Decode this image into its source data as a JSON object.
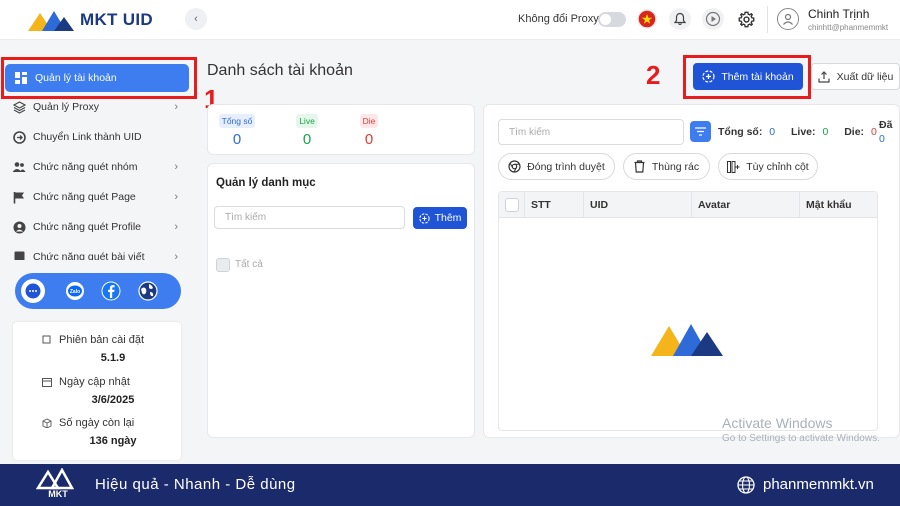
{
  "app": {
    "logo_text": "MKT UID"
  },
  "topbar": {
    "proxy_label": "Không đổi Proxy",
    "proxy_enabled": false,
    "user_name": "Chinh Trịnh",
    "user_email": "chinhtt@phanmemmkt"
  },
  "sidebar": {
    "items": [
      {
        "label": "Quản lý tài khoản",
        "icon": "grid-icon",
        "active": true
      },
      {
        "label": "Quản lý Proxy",
        "icon": "layers-icon",
        "has_children": true
      },
      {
        "label": "Chuyển Link thành UID",
        "icon": "link-icon"
      },
      {
        "label": "Chức năng quét nhóm",
        "icon": "users-icon",
        "has_children": true
      },
      {
        "label": "Chức năng quét Page",
        "icon": "flag-icon",
        "has_children": true
      },
      {
        "label": "Chức năng quét Profile",
        "icon": "user-circle-icon",
        "has_children": true
      },
      {
        "label": "Chức năng quét bài viết",
        "icon": "document-icon",
        "has_children": true
      }
    ],
    "social": [
      "chat-support-icon",
      "zalo-icon",
      "facebook-icon",
      "globe-icon"
    ],
    "info": {
      "version_label": "Phiên bản cài đặt",
      "version_value": "5.1.9",
      "updated_label": "Ngày cập nhật",
      "updated_value": "3/6/2025",
      "days_label": "Số ngày còn lại",
      "days_value": "136 ngày"
    }
  },
  "annotations": {
    "marker1": "1",
    "marker2": "2"
  },
  "main": {
    "title": "Danh sách tài khoản",
    "add_account_button": "Thêm tài khoản",
    "export_button": "Xuất dữ liệu",
    "stats": [
      {
        "label": "Tổng số",
        "value": "0",
        "color": "#2e6bd9"
      },
      {
        "label": "Live",
        "value": "0",
        "color": "#19a34a"
      },
      {
        "label": "Die",
        "value": "0",
        "color": "#e03b3b"
      }
    ],
    "category": {
      "title": "Quản lý danh mục",
      "search_placeholder": "Tìm kiếm",
      "add_button": "Thêm",
      "select_all": "Tất cả"
    },
    "accounts": {
      "search_placeholder": "Tìm kiếm",
      "total_label": "Tổng số:",
      "total_value": "0",
      "live_label": "Live:",
      "live_value": "0",
      "die_label": "Die:",
      "die_value": "0",
      "extra_label": "Đã",
      "extra_value": "0",
      "close_browser_button": "Đóng trình duyệt",
      "trash_button": "Thùng rác",
      "customize_columns_button": "Tùy chỉnh cột",
      "columns": [
        "STT",
        "UID",
        "Avatar",
        "Mật khẩu"
      ]
    }
  },
  "watermark": {
    "line1": "Activate Windows",
    "line2": "Go to Settings to activate Windows."
  },
  "footer": {
    "slogan": "Hiệu quả - Nhanh - Dễ dùng",
    "website": "phanmemmkt.vn",
    "logo_text": "MKT"
  },
  "colors": {
    "primary": "#1f54d6",
    "active_nav": "#3d7df0",
    "footer": "#1b2a6b",
    "annotation": "#e81c1c"
  }
}
